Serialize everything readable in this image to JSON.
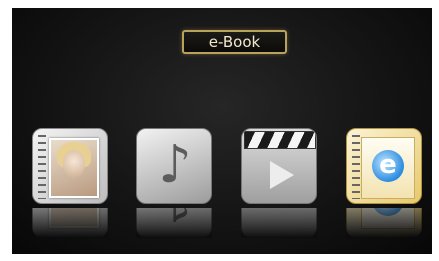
{
  "header": {
    "title": "e-Book"
  },
  "menu": {
    "items": [
      {
        "icon": "photo-album-icon"
      },
      {
        "icon": "music-note-icon"
      },
      {
        "icon": "video-clapper-icon"
      },
      {
        "icon": "ebook-icon",
        "selected": true
      }
    ]
  },
  "colors": {
    "background": "#141414",
    "title_border": "#b9a25a",
    "title_text": "#f0e9cc",
    "ebook_accent": "#e7c96c"
  }
}
